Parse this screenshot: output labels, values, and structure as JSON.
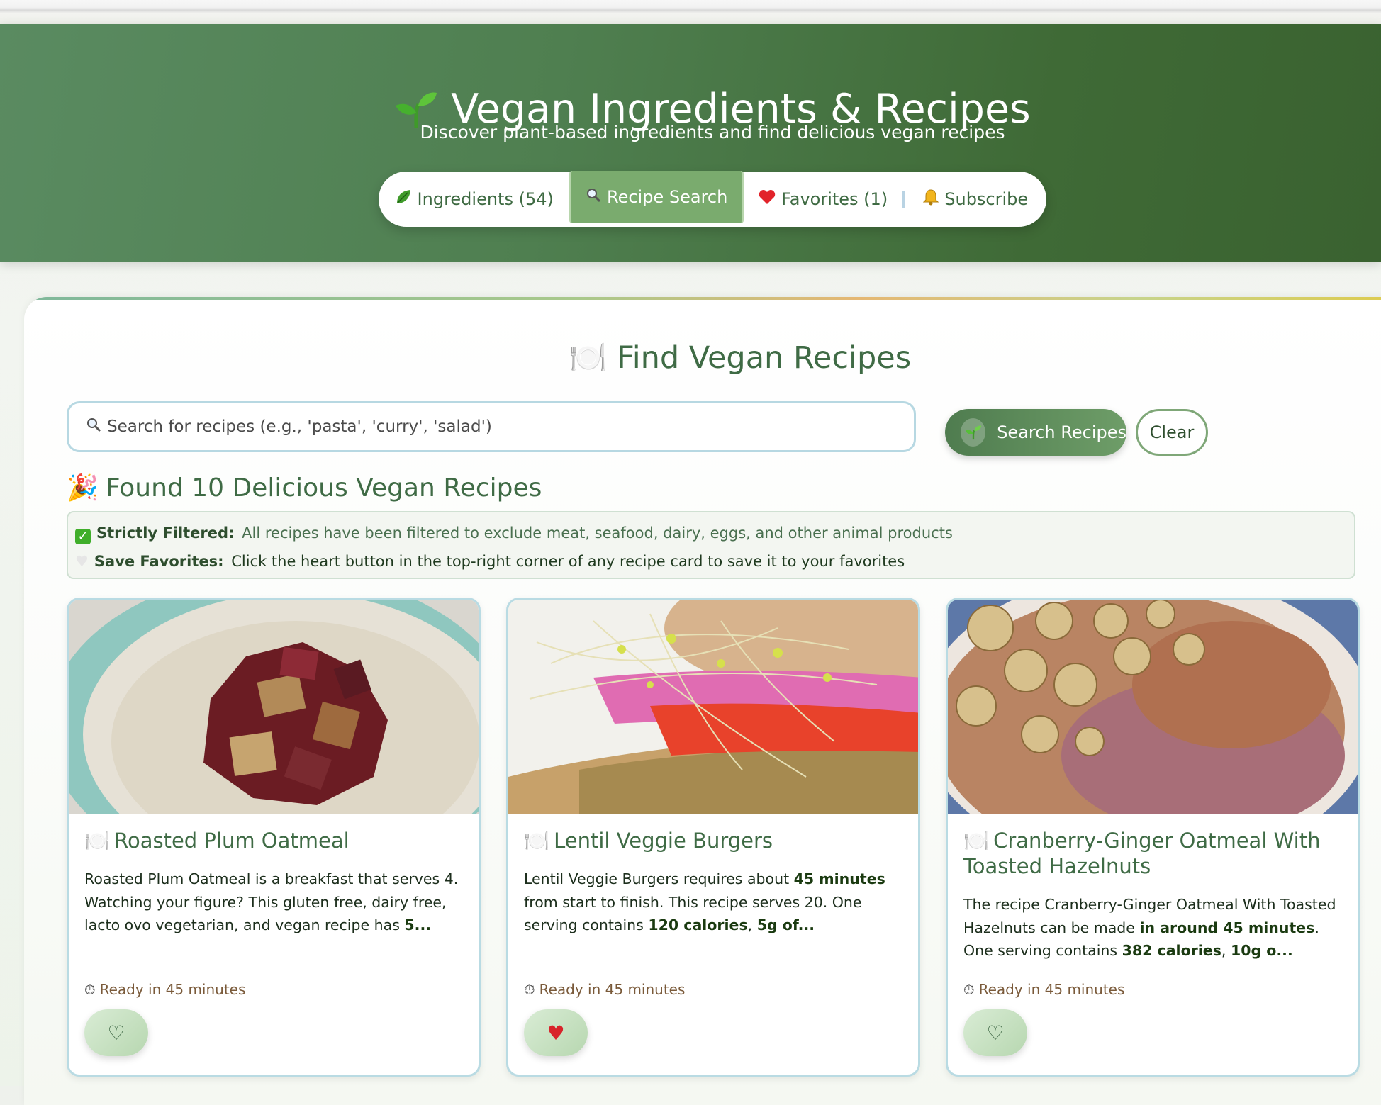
{
  "header": {
    "title": "Vegan Ingredients & Recipes",
    "subtitle": "Discover plant-based ingredients and find delicious vegan recipes"
  },
  "nav": {
    "tabs": [
      {
        "label": "Ingredients (54)",
        "icon": "leaf-icon"
      },
      {
        "label": "Recipe Search",
        "icon": "magnifier-icon",
        "active": true
      },
      {
        "label": "Favorites (1)",
        "icon": "heart-icon"
      },
      {
        "label": "Subscribe",
        "icon": "bell-icon"
      }
    ]
  },
  "search": {
    "title": "Find Vegan Recipes",
    "placeholder": "Search for recipes (e.g., 'pasta', 'curry', 'salad')",
    "search_button": "Search Recipes",
    "clear_button": "Clear"
  },
  "results": {
    "title": "Found 10 Delicious Vegan Recipes",
    "notice1_label": "Strictly Filtered:",
    "notice1_text": "All recipes have been filtered to exclude meat, seafood, dairy, eggs, and other animal products",
    "notice2_label": "Save Favorites:",
    "notice2_text": "Click the heart button in the top-right corner of any recipe card to save it to your favorites"
  },
  "recipes": [
    {
      "name": "Roasted Plum Oatmeal",
      "desc_parts": [
        "Roasted Plum Oatmeal is a breakfast that serves 4. Watching your figure? This gluten free, dairy free, lacto ovo vegetarian, and vegan recipe has ",
        "5..."
      ],
      "ready": "Ready in 45 minutes",
      "favorited": false
    },
    {
      "name": "Lentil Veggie Burgers",
      "desc_parts": [
        "Lentil Veggie Burgers requires about ",
        "45 minutes",
        " from start to finish. This recipe serves 20. One serving contains ",
        "120 calories",
        ", ",
        "5g of..."
      ],
      "ready": "Ready in 45 minutes",
      "favorited": true
    },
    {
      "name": "Cranberry-Ginger Oatmeal With Toasted Hazelnuts",
      "desc_parts": [
        "The recipe Cranberry-Ginger Oatmeal With Toasted Hazelnuts can be made ",
        "in around 45 minutes",
        ". One serving contains ",
        "382 calories",
        ", ",
        "10g o..."
      ],
      "ready": "Ready in 45 minutes",
      "favorited": false
    }
  ],
  "colors": {
    "header_bg": "#4f7f50",
    "active_tab": "#7aab6e",
    "accent_text": "#3f6b45",
    "heart_red": "#d8232a"
  }
}
